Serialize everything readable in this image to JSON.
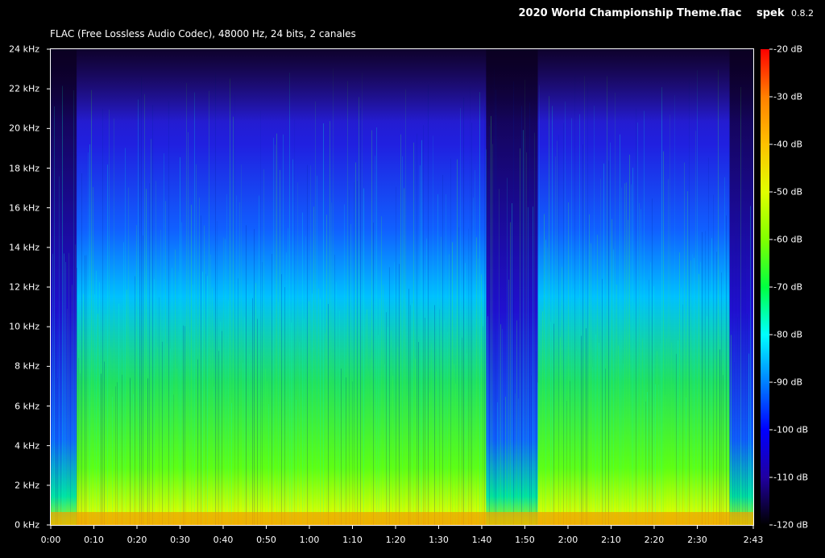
{
  "header": {
    "file_title": "2020 World Championship Theme.flac",
    "app_name": "spek",
    "app_version": "0.8.2"
  },
  "file_info": "FLAC (Free Lossless Audio Codec), 48000 Hz, 24 bits, 2 canales",
  "frequency_axis": {
    "labels": [
      "0 kHz",
      "2 kHz",
      "4 kHz",
      "6 kHz",
      "8 kHz",
      "10 kHz",
      "12 kHz",
      "14 kHz",
      "16 kHz",
      "18 kHz",
      "20 kHz",
      "22 kHz",
      "24 kHz"
    ],
    "max_khz": 24
  },
  "time_axis": {
    "labels": [
      "0:00",
      "0:10",
      "0:20",
      "0:30",
      "0:40",
      "0:50",
      "1:00",
      "1:10",
      "1:20",
      "1:30",
      "1:40",
      "1:50",
      "2:00",
      "2:10",
      "2:20",
      "2:30",
      "2:43"
    ],
    "label_seconds": [
      0,
      10,
      20,
      30,
      40,
      50,
      60,
      70,
      80,
      90,
      100,
      110,
      120,
      130,
      140,
      150,
      163
    ],
    "duration_seconds": 163
  },
  "color_scale": {
    "labels": [
      "-20 dB",
      "-30 dB",
      "-40 dB",
      "-50 dB",
      "-60 dB",
      "-70 dB",
      "-80 dB",
      "-90 dB",
      "-100 dB",
      "-110 dB",
      "-120 dB"
    ],
    "colors": [
      "#ff0000",
      "#ff8000",
      "#ffff00",
      "#80ff00",
      "#00ff00",
      "#00ffff",
      "#0080ff",
      "#0000ff",
      "#3000b0",
      "#1a0040",
      "#000000"
    ]
  },
  "colors": {
    "background": "#000000",
    "text": "#ffffff",
    "frame": "#ffffff"
  }
}
